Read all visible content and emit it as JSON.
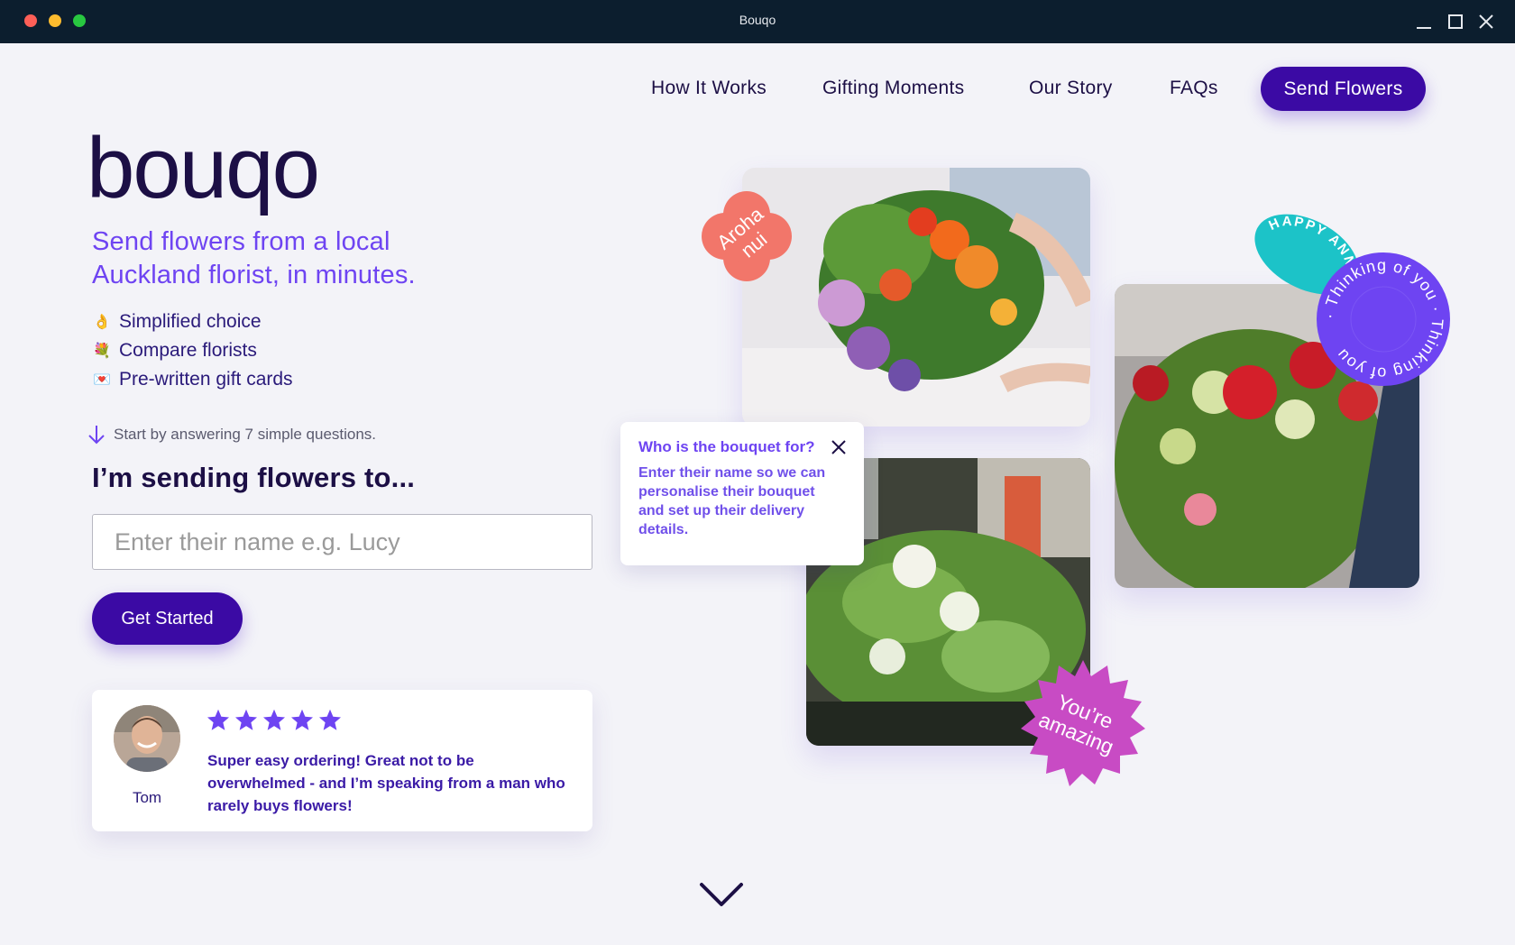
{
  "window": {
    "title": "Bouqo"
  },
  "nav": {
    "links": [
      "How It Works",
      "Gifting Moments",
      "Our Story",
      "FAQs"
    ],
    "cta": "Send Flowers"
  },
  "hero": {
    "logo": "bouqo",
    "tagline": "Send flowers from a local Auckland florist, in minutes.",
    "benefits": [
      {
        "icon": "ok-hand-icon",
        "emoji": "👌",
        "text": "Simplified choice"
      },
      {
        "icon": "bouquet-icon",
        "emoji": "💐",
        "text": "Compare florists"
      },
      {
        "icon": "love-letter-icon",
        "emoji": "💌",
        "text": "Pre-written gift cards"
      }
    ],
    "hint": "Start by answering 7 simple questions.",
    "heading": "I’m sending flowers to...",
    "input_placeholder": "Enter their name e.g. Lucy",
    "input_value": "",
    "button": "Get Started"
  },
  "review": {
    "rating": 5,
    "name": "Tom",
    "text": "Super easy ordering! Great not to be overwhelmed - and I’m speaking from a man who rarely buys flowers!"
  },
  "tooltip": {
    "question": "Who is the bouquet for?",
    "text": "Enter their name so we can personalise their bouquet and set up their delivery details."
  },
  "stickers": {
    "aroha_line1": "Aroha",
    "aroha_line2": "nui",
    "anniversary": "HAPPY ANNIVERSARY",
    "thinking": "· Thinking of you · Thinking of you",
    "amazing_line1": "You’re",
    "amazing_line2": "amazing"
  },
  "colors": {
    "brand_purple": "#3b0aa4",
    "accent_violet": "#6e44f2",
    "navy": "#1c0f45",
    "coral": "#f2766a",
    "teal": "#1cc3c8",
    "magenta": "#c84bc4",
    "star": "#6e44f2"
  }
}
